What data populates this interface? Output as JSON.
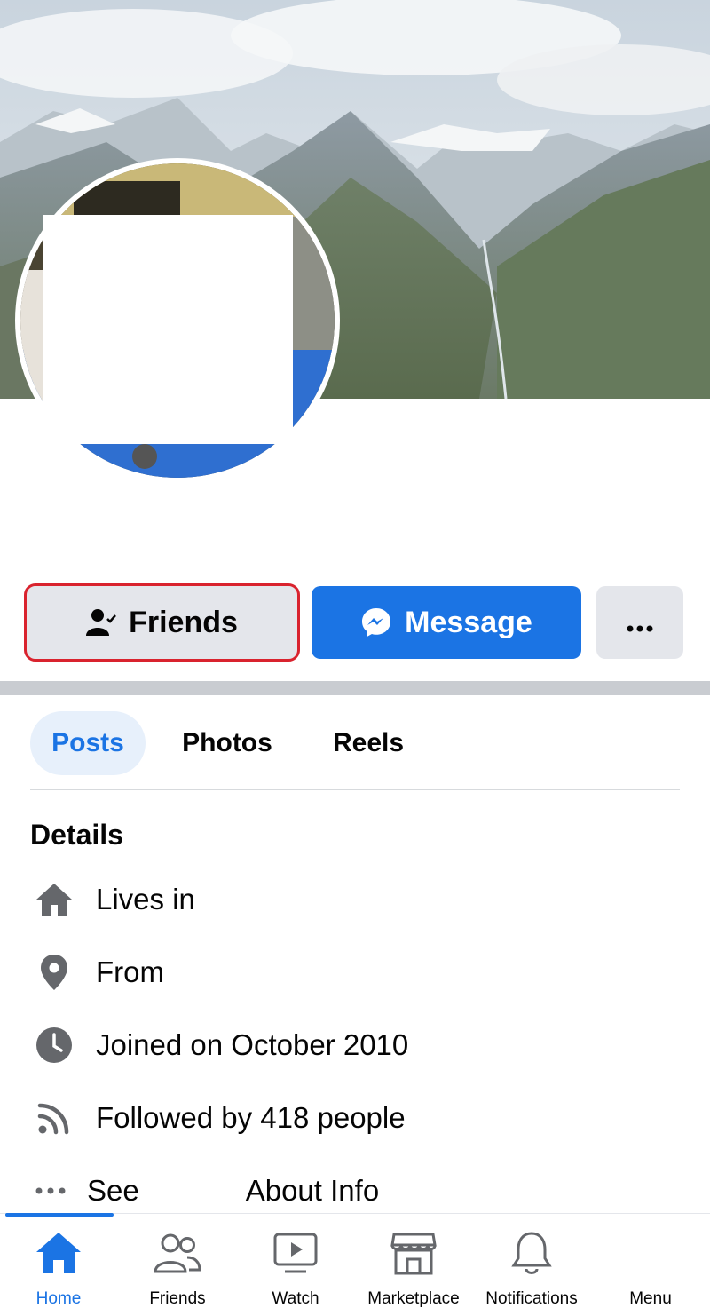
{
  "actions": {
    "friends_label": "Friends",
    "message_label": "Message"
  },
  "tabs": [
    {
      "label": "Posts",
      "active": true
    },
    {
      "label": "Photos",
      "active": false
    },
    {
      "label": "Reels",
      "active": false
    }
  ],
  "details": {
    "title": "Details",
    "items": [
      {
        "icon": "home-icon",
        "text": "Lives in"
      },
      {
        "icon": "location-pin-icon",
        "text": "From"
      },
      {
        "icon": "clock-icon",
        "text": "Joined on October 2010"
      },
      {
        "icon": "rss-followers-icon",
        "text": "Followed by 418 people"
      }
    ],
    "see_word": "See",
    "about_info": "About Info"
  },
  "nav": {
    "items": [
      {
        "label": "Home",
        "icon": "home-icon",
        "active": true
      },
      {
        "label": "Friends",
        "icon": "friends-icon",
        "active": false
      },
      {
        "label": "Watch",
        "icon": "watch-icon",
        "active": false
      },
      {
        "label": "Marketplace",
        "icon": "marketplace-icon",
        "active": false
      },
      {
        "label": "Notifications",
        "icon": "bell-icon",
        "active": false
      },
      {
        "label": "Menu",
        "icon": "menu-icon",
        "active": false
      }
    ]
  },
  "colors": {
    "accent": "#1b74e4",
    "button_gray": "#e4e6eb",
    "highlight_border": "#d9232e"
  }
}
